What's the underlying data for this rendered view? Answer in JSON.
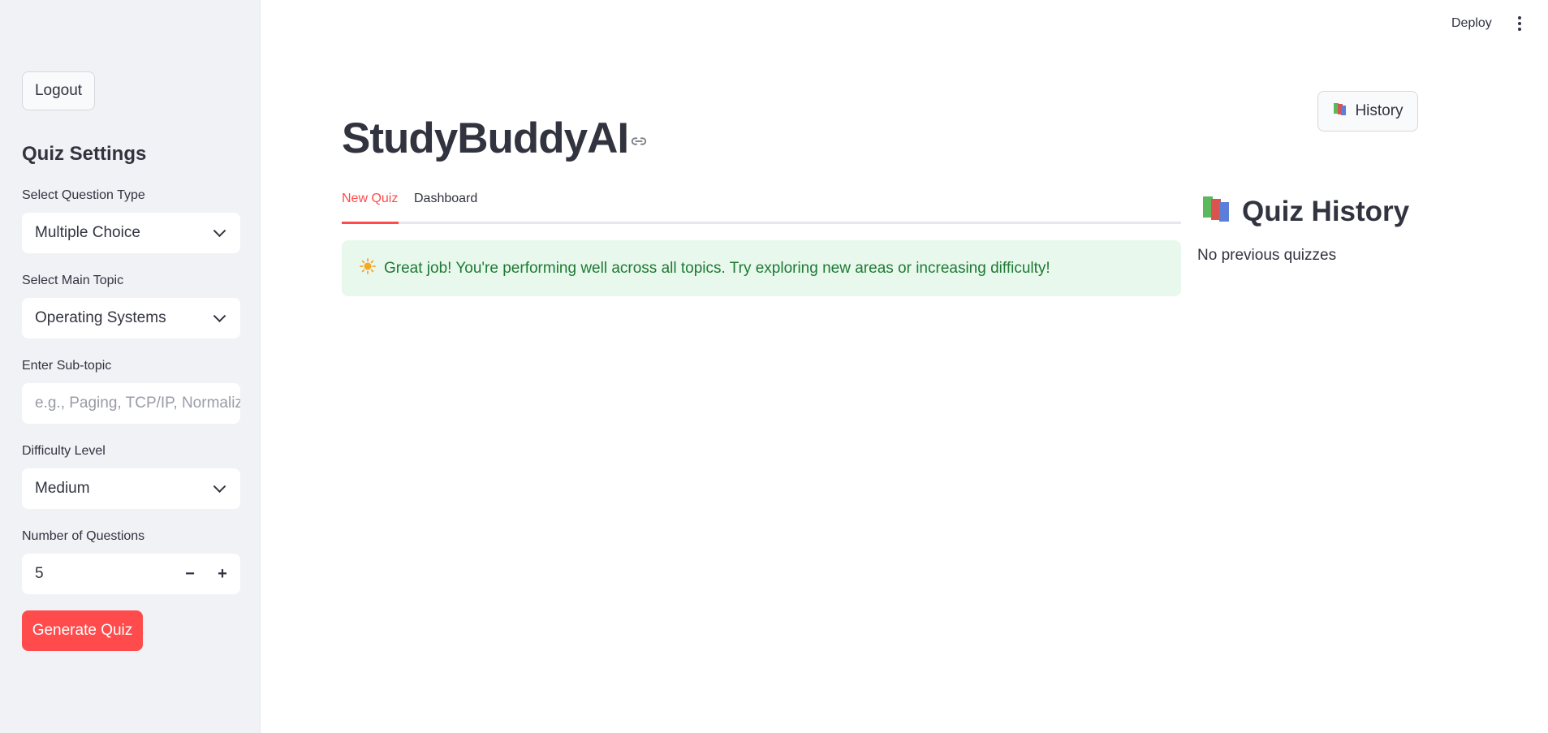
{
  "sidebar": {
    "logout_label": "Logout",
    "title": "Quiz Settings",
    "question_type": {
      "label": "Select Question Type",
      "value": "Multiple Choice"
    },
    "main_topic": {
      "label": "Select Main Topic",
      "value": "Operating Systems"
    },
    "sub_topic": {
      "label": "Enter Sub-topic",
      "placeholder": "e.g., Paging, TCP/IP, Normaliz"
    },
    "difficulty": {
      "label": "Difficulty Level",
      "value": "Medium"
    },
    "num_questions": {
      "label": "Number of Questions",
      "value": "5",
      "minus": "−",
      "plus": "+"
    },
    "generate_label": "Generate Quiz"
  },
  "header": {
    "deploy_label": "Deploy"
  },
  "main": {
    "title": "StudyBuddyAI",
    "history_button_label": "History",
    "tabs": [
      {
        "label": "New Quiz",
        "active": true
      },
      {
        "label": "Dashboard",
        "active": false
      }
    ],
    "alert": {
      "icon": "sun-icon",
      "text": "Great job! You're performing well across all topics. Try exploring new areas or increasing difficulty!"
    }
  },
  "history_panel": {
    "title": "Quiz History",
    "empty_text": "No previous quizzes"
  },
  "colors": {
    "accent": "#ff4b4b",
    "sidebar_bg": "#f0f2f6",
    "success_bg": "#e8f8ec",
    "success_text": "#1f7a35",
    "text": "#31333f"
  }
}
